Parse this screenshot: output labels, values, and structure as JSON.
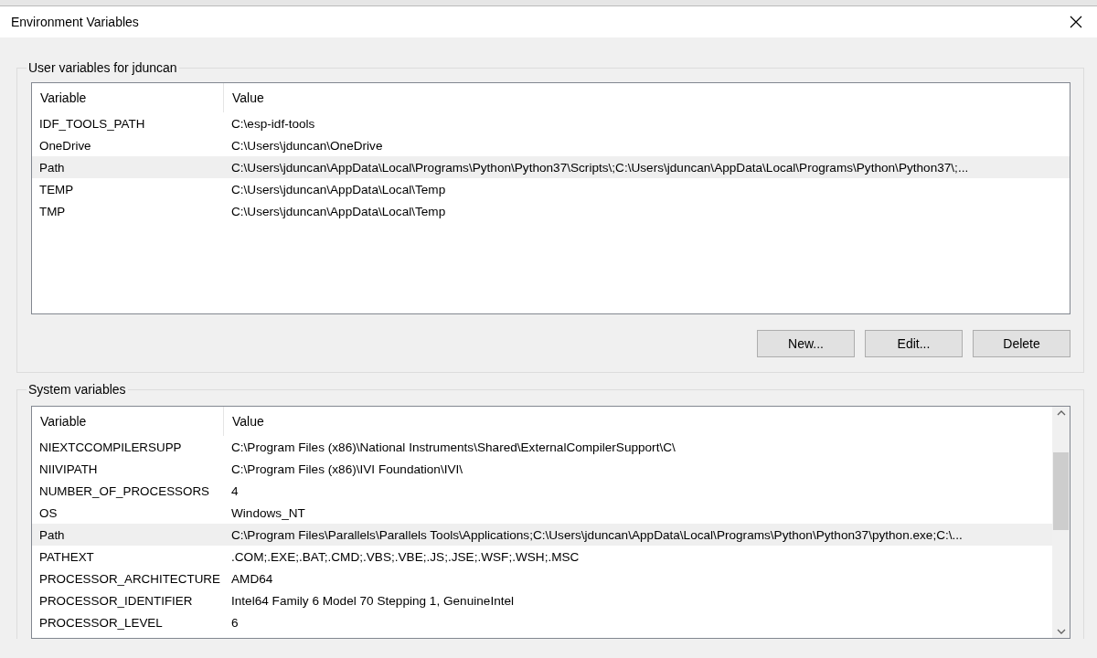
{
  "window": {
    "title": "Environment Variables"
  },
  "user_variables": {
    "label": "User variables for jduncan",
    "columns": [
      "Variable",
      "Value"
    ],
    "rows": [
      {
        "variable": "IDF_TOOLS_PATH",
        "value": "C:\\esp-idf-tools",
        "selected": false
      },
      {
        "variable": "OneDrive",
        "value": "C:\\Users\\jduncan\\OneDrive",
        "selected": false
      },
      {
        "variable": "Path",
        "value": "C:\\Users\\jduncan\\AppData\\Local\\Programs\\Python\\Python37\\Scripts\\;C:\\Users\\jduncan\\AppData\\Local\\Programs\\Python\\Python37\\;...",
        "selected": true
      },
      {
        "variable": "TEMP",
        "value": "C:\\Users\\jduncan\\AppData\\Local\\Temp",
        "selected": false
      },
      {
        "variable": "TMP",
        "value": "C:\\Users\\jduncan\\AppData\\Local\\Temp",
        "selected": false
      }
    ],
    "buttons": [
      "New...",
      "Edit...",
      "Delete"
    ]
  },
  "system_variables": {
    "label": "System variables",
    "columns": [
      "Variable",
      "Value"
    ],
    "rows": [
      {
        "variable": "NIEXTCCOMPILERSUPP",
        "value": "C:\\Program Files (x86)\\National Instruments\\Shared\\ExternalCompilerSupport\\C\\",
        "selected": false
      },
      {
        "variable": "NIIVIPATH",
        "value": "C:\\Program Files (x86)\\IVI Foundation\\IVI\\",
        "selected": false
      },
      {
        "variable": "NUMBER_OF_PROCESSORS",
        "value": "4",
        "selected": false
      },
      {
        "variable": "OS",
        "value": "Windows_NT",
        "selected": false
      },
      {
        "variable": "Path",
        "value": "C:\\Program Files\\Parallels\\Parallels Tools\\Applications;C:\\Users\\jduncan\\AppData\\Local\\Programs\\Python\\Python37\\python.exe;C:\\...",
        "selected": true
      },
      {
        "variable": "PATHEXT",
        "value": ".COM;.EXE;.BAT;.CMD;.VBS;.VBE;.JS;.JSE;.WSF;.WSH;.MSC",
        "selected": false
      },
      {
        "variable": "PROCESSOR_ARCHITECTURE",
        "value": "AMD64",
        "selected": false
      },
      {
        "variable": "PROCESSOR_IDENTIFIER",
        "value": "Intel64 Family 6 Model 70 Stepping 1, GenuineIntel",
        "selected": false
      },
      {
        "variable": "PROCESSOR_LEVEL",
        "value": "6",
        "selected": false
      }
    ]
  }
}
